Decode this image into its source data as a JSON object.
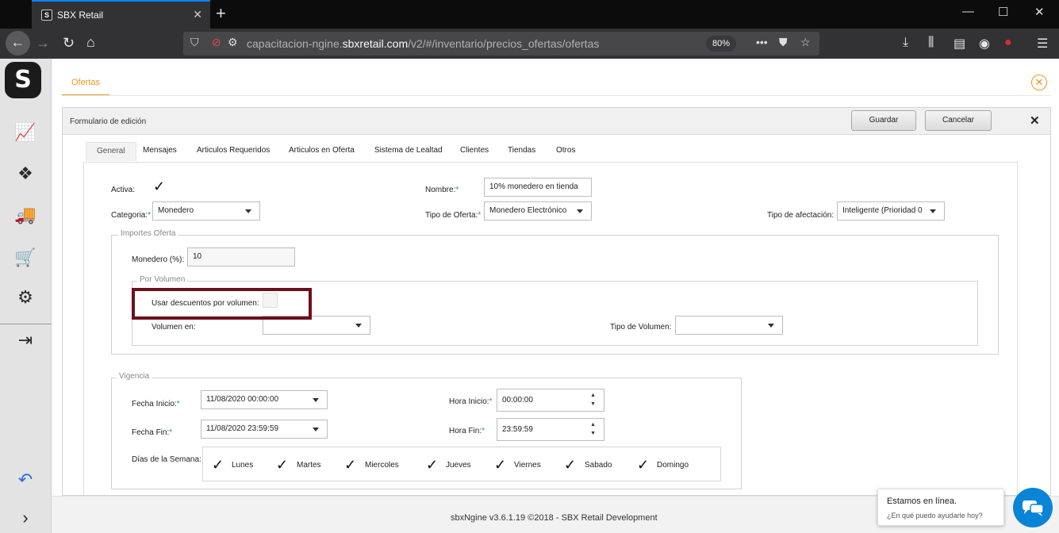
{
  "browser": {
    "tab_title": "SBX Retail",
    "url_host": "capacitacion-ngine.",
    "url_domain": "sbxretail.com",
    "url_path": "/v2/#/inventario/precios_ofertas/ofertas",
    "zoom": "80%"
  },
  "page_tab": "Ofertas",
  "panel": {
    "title": "Formulario de edición",
    "save_label": "Guardar",
    "cancel_label": "Cancelar"
  },
  "tabs": [
    "General",
    "Mensajes",
    "Articulos Requeridos",
    "Articulos en Oferta",
    "Sistema de Lealtad",
    "Clientes",
    "Tiendas",
    "Otros"
  ],
  "general": {
    "activa_label": "Activa:",
    "activa_checked": true,
    "nombre_label": "Nombre:",
    "nombre_value": "10% monedero en tienda",
    "categoria_label": "Categoria:",
    "categoria_value": "Monedero",
    "tipo_oferta_label": "Tipo de Oferta:",
    "tipo_oferta_value": "Monedero Electrónico",
    "tipo_afectacion_label": "Tipo de afectación:",
    "tipo_afectacion_value": "Inteligente (Prioridad 0"
  },
  "importes": {
    "legend": "Importes Oferta",
    "monedero_label": "Monedero (%):",
    "monedero_value": "10",
    "por_volumen": {
      "legend": "Por Volumen",
      "usar_label": "Usar descuentos por volumen:",
      "volumen_en_label": "Volumen en:",
      "volumen_en_value": "",
      "tipo_volumen_label": "Tipo de Volumen:",
      "tipo_volumen_value": ""
    }
  },
  "vigencia": {
    "legend": "Vigencia",
    "fecha_inicio_label": "Fecha Inicio:",
    "fecha_inicio_value": "11/08/2020 00:00:00",
    "hora_inicio_label": "Hora Inicio:",
    "hora_inicio_value": "00:00:00",
    "fecha_fin_label": "Fecha Fin:",
    "fecha_fin_value": "11/08/2020 23:59:59",
    "hora_fin_label": "Hora Fin:",
    "hora_fin_value": "23:59:59",
    "dias_label": "Días de la Semana:",
    "dias": [
      {
        "label": "Lunes",
        "checked": true
      },
      {
        "label": "Martes",
        "checked": true
      },
      {
        "label": "Miercoles",
        "checked": true
      },
      {
        "label": "Jueves",
        "checked": true
      },
      {
        "label": "Viernes",
        "checked": true
      },
      {
        "label": "Sabado",
        "checked": true
      },
      {
        "label": "Domingo",
        "checked": true
      }
    ]
  },
  "footer": "sbxNgine v3.6.1.19 ©2018 - SBX Retail Development",
  "chat": {
    "title": "Estamos en línea.",
    "subtitle": "¿En qué puedo ayudarle hoy?"
  },
  "colors": {
    "accent": "#e89a1a",
    "highlight": "#6e0f1c",
    "required": "#2a9d3a",
    "chat": "#0a84d6"
  }
}
